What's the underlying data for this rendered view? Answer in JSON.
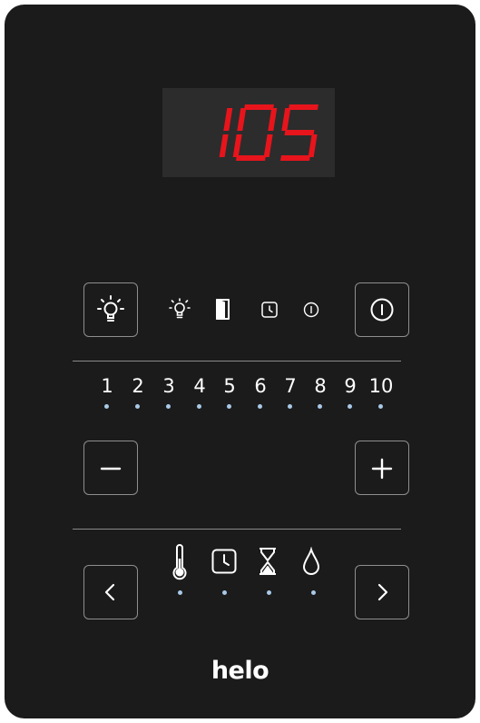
{
  "display": {
    "value": "105",
    "segment_color": "#e8141c"
  },
  "colors": {
    "panel": "#1b1b1b",
    "display_bg": "#2c2c2c",
    "indicator_dot": "#a9c9e8"
  },
  "top_row": {
    "left_button_icon": "light-bulb-icon",
    "indicators": [
      "light-bulb-icon",
      "door-icon",
      "clock-icon",
      "power-icon"
    ],
    "right_button_icon": "power-icon"
  },
  "levels": [
    "1",
    "2",
    "3",
    "4",
    "5",
    "6",
    "7",
    "8",
    "9",
    "10"
  ],
  "adjust": {
    "minus_icon": "minus-icon",
    "plus_icon": "plus-icon"
  },
  "bottom_row": {
    "left_button_icon": "chevron-left-icon",
    "modes": [
      "thermometer-icon",
      "clock-icon",
      "hourglass-icon",
      "water-drop-icon"
    ],
    "right_button_icon": "chevron-right-icon"
  },
  "brand": "helo"
}
